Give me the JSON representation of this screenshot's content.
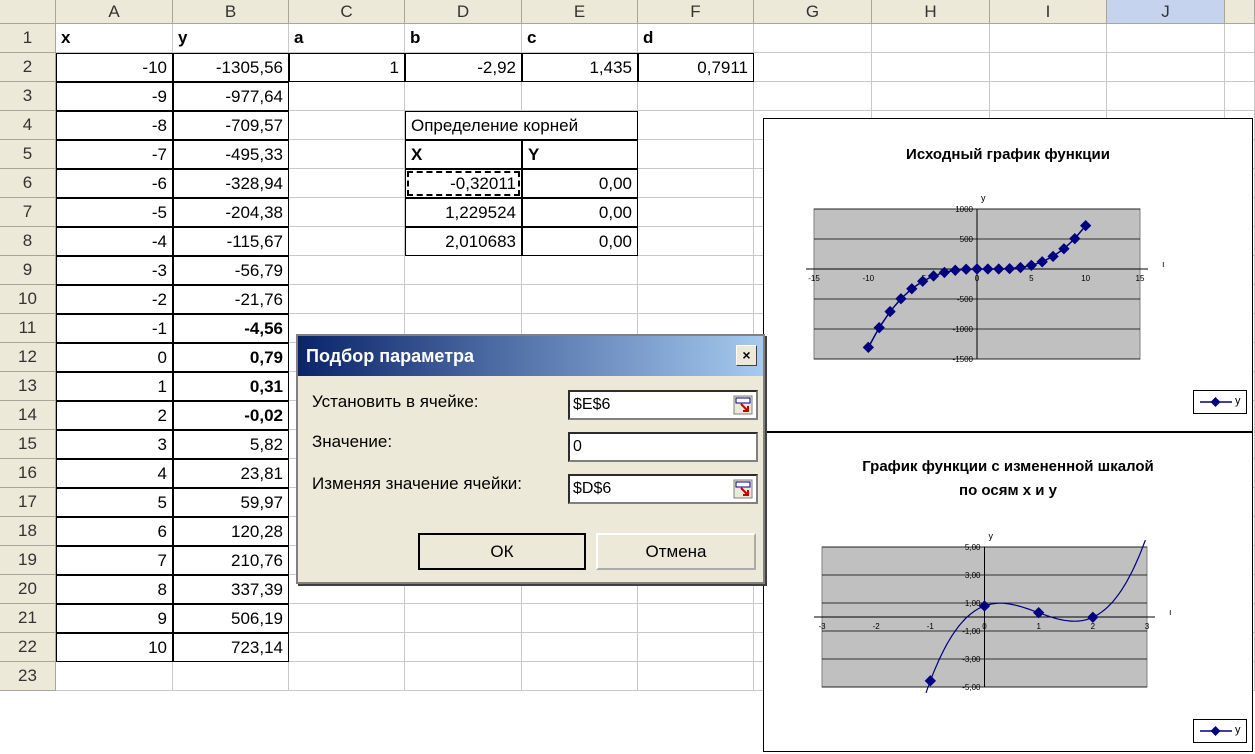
{
  "columns": [
    "A",
    "B",
    "C",
    "D",
    "E",
    "F",
    "G",
    "H",
    "I",
    "J"
  ],
  "selected_column": "J",
  "rows": [
    "1",
    "2",
    "3",
    "4",
    "5",
    "6",
    "7",
    "8",
    "9",
    "10",
    "11",
    "12",
    "13",
    "14",
    "15",
    "16",
    "17",
    "18",
    "19",
    "20",
    "21",
    "22",
    "23"
  ],
  "header_row": {
    "x": "x",
    "y": "y",
    "a": "a",
    "b": "b",
    "c": "c",
    "d": "d"
  },
  "coefficients": {
    "a": "1",
    "b": "-2,92",
    "c": "1,435",
    "d": "0,7911"
  },
  "x_values": [
    "-10",
    "-9",
    "-8",
    "-7",
    "-6",
    "-5",
    "-4",
    "-3",
    "-2",
    "-1",
    "0",
    "1",
    "2",
    "3",
    "4",
    "5",
    "6",
    "7",
    "8",
    "9",
    "10"
  ],
  "y_values": [
    "-1305,56",
    "-977,64",
    "-709,57",
    "-495,33",
    "-328,94",
    "-204,38",
    "-115,67",
    "-56,79",
    "-21,76",
    "-4,56",
    "0,79",
    "0,31",
    "-0,02",
    "5,82",
    "23,81",
    "59,97",
    "120,28",
    "210,76",
    "337,39",
    "506,19",
    "723,14"
  ],
  "roots_table": {
    "title": "Определение корней",
    "col_x": "X",
    "col_y": "Y",
    "rows": [
      {
        "x": "-0,32011",
        "y": "0,00"
      },
      {
        "x": "1,229524",
        "y": "0,00"
      },
      {
        "x": "2,010683",
        "y": "0,00"
      }
    ]
  },
  "dialog": {
    "title": "Подбор параметра",
    "close": "×",
    "set_cell_label": "Установить в ячейке:",
    "set_cell_value": "$E$6",
    "value_label": "Значение:",
    "value_value": "0",
    "changing_label": "Изменяя значение ячейки:",
    "changing_value": "$D$6",
    "ok": "ОК",
    "cancel": "Отмена"
  },
  "chart_data": [
    {
      "type": "scatter",
      "title": "Исходный график функции",
      "ylabel": "y",
      "x": [
        -10,
        -9,
        -8,
        -7,
        -6,
        -5,
        -4,
        -3,
        -2,
        -1,
        0,
        1,
        2,
        3,
        4,
        5,
        6,
        7,
        8,
        9,
        10
      ],
      "series": [
        {
          "name": "y",
          "values": [
            -1305.56,
            -977.64,
            -709.57,
            -495.33,
            -328.94,
            -204.38,
            -115.67,
            -56.79,
            -21.76,
            -4.56,
            0.79,
            0.31,
            -0.02,
            5.82,
            23.81,
            59.97,
            120.28,
            210.76,
            337.39,
            506.19,
            723.14
          ]
        }
      ],
      "xlim": [
        -15,
        15
      ],
      "ylim": [
        -1500,
        1000
      ],
      "xticks": [
        "-15",
        "-10",
        "-5",
        "0",
        "5",
        "10",
        "15"
      ],
      "yticks": [
        "1000",
        "500",
        "",
        "-500",
        "-1000",
        "-1500"
      ],
      "grid": true,
      "legend": "bottom-right"
    },
    {
      "type": "scatter",
      "title": "График функции с измененной шкалой по осям x и y",
      "ylabel": "y",
      "x": [
        -1,
        0,
        1,
        2
      ],
      "series": [
        {
          "name": "y",
          "values": [
            -4.56,
            0.79,
            0.31,
            -0.02
          ]
        }
      ],
      "xlim": [
        -3,
        3
      ],
      "ylim": [
        -5,
        5
      ],
      "xticks": [
        "-3",
        "-2",
        "-1",
        "0",
        "1",
        "2",
        "3"
      ],
      "yticks": [
        "5,00",
        "3,00",
        "1,00",
        "-1,00",
        "-3,00",
        "-5,00"
      ],
      "grid": true,
      "legend": "bottom-right"
    }
  ]
}
